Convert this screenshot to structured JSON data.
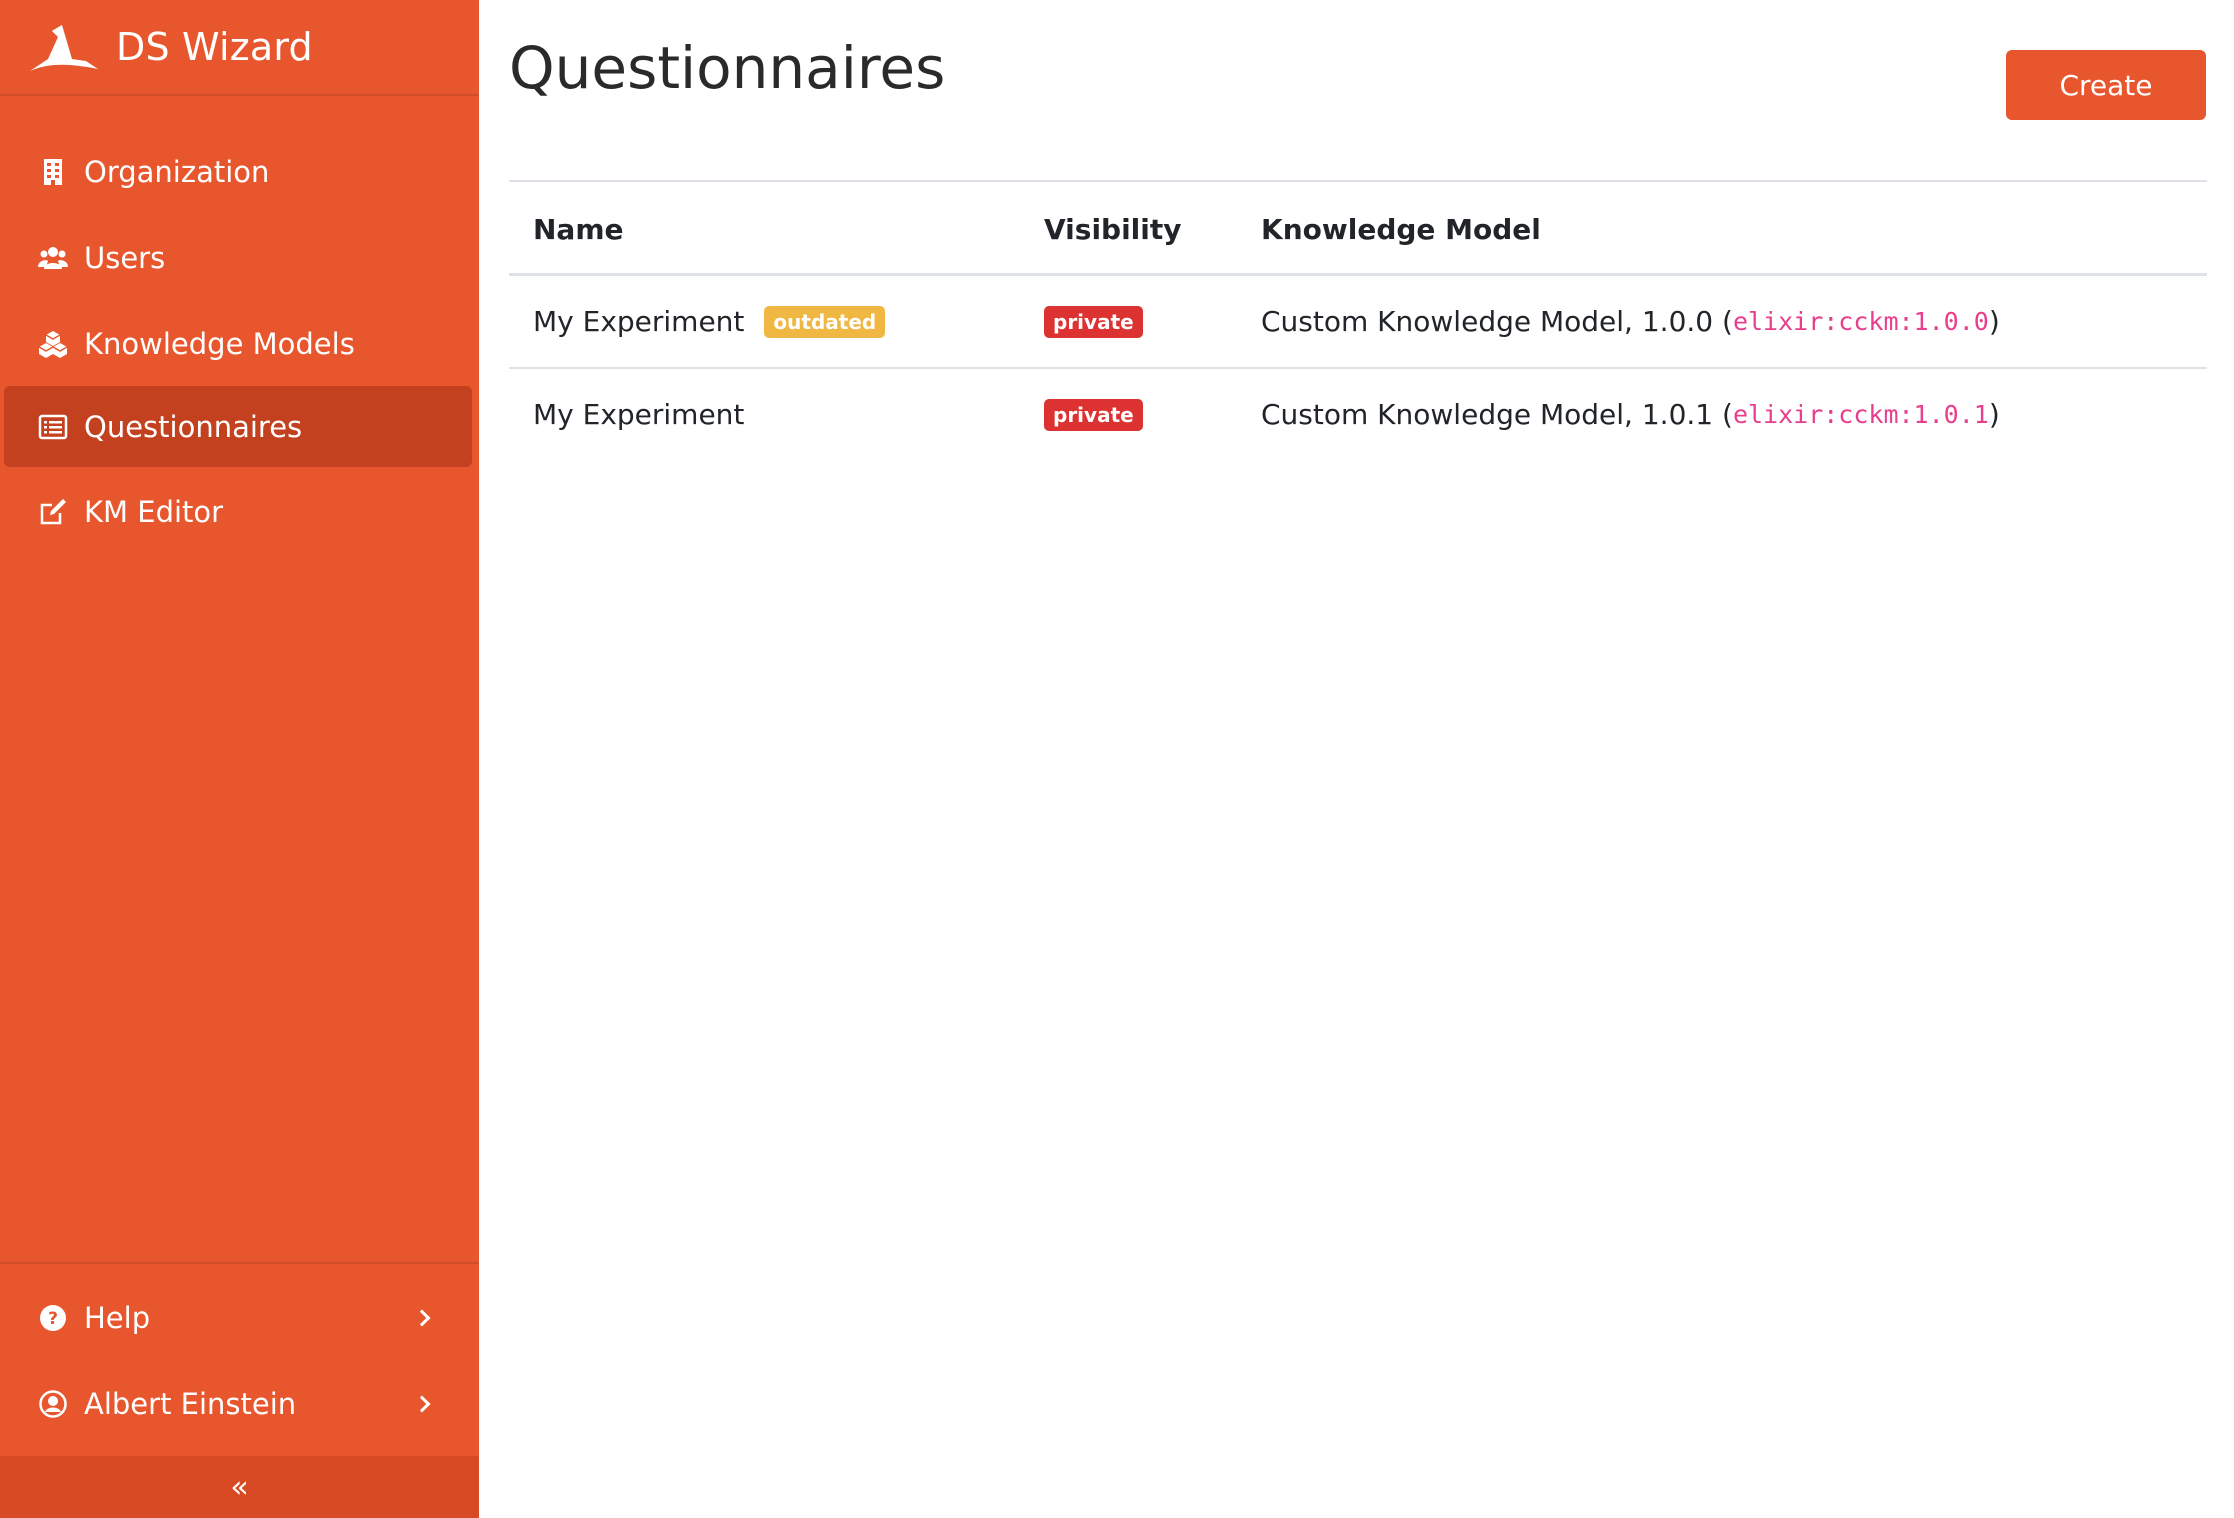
{
  "app": {
    "brand_name": "DS Wizard"
  },
  "sidebar": {
    "items": [
      {
        "label": "Organization",
        "icon": "building-icon",
        "active": false
      },
      {
        "label": "Users",
        "icon": "users-icon",
        "active": false
      },
      {
        "label": "Knowledge Models",
        "icon": "cubes-icon",
        "active": false
      },
      {
        "label": "Questionnaires",
        "icon": "list-alt-icon",
        "active": true
      },
      {
        "label": "KM Editor",
        "icon": "edit-icon",
        "active": false
      }
    ],
    "bottom": [
      {
        "label": "Help",
        "icon": "question-circle-icon"
      },
      {
        "label": "Albert Einstein",
        "icon": "user-circle-icon"
      }
    ],
    "collapse_glyph": "«"
  },
  "page": {
    "title": "Questionnaires",
    "create_label": "Create"
  },
  "table": {
    "headers": [
      "Name",
      "Visibility",
      "Knowledge Model"
    ],
    "rows": [
      {
        "name": "My Experiment",
        "badge": "outdated",
        "visibility": "private",
        "km_text": "Custom Knowledge Model, 1.0.0 (",
        "km_id": "elixir:cckm:1.0.0",
        "km_close": ")"
      },
      {
        "name": "My Experiment",
        "badge": "",
        "visibility": "private",
        "km_text": "Custom Knowledge Model, 1.0.1 (",
        "km_id": "elixir:cckm:1.0.1",
        "km_close": ")"
      }
    ]
  },
  "colors": {
    "sidebar_bg": "#e8562d",
    "sidebar_active": "#c3411f",
    "outdated_badge": "#f0b742",
    "private_badge": "#dc3232",
    "code_text": "#e83e8c"
  }
}
